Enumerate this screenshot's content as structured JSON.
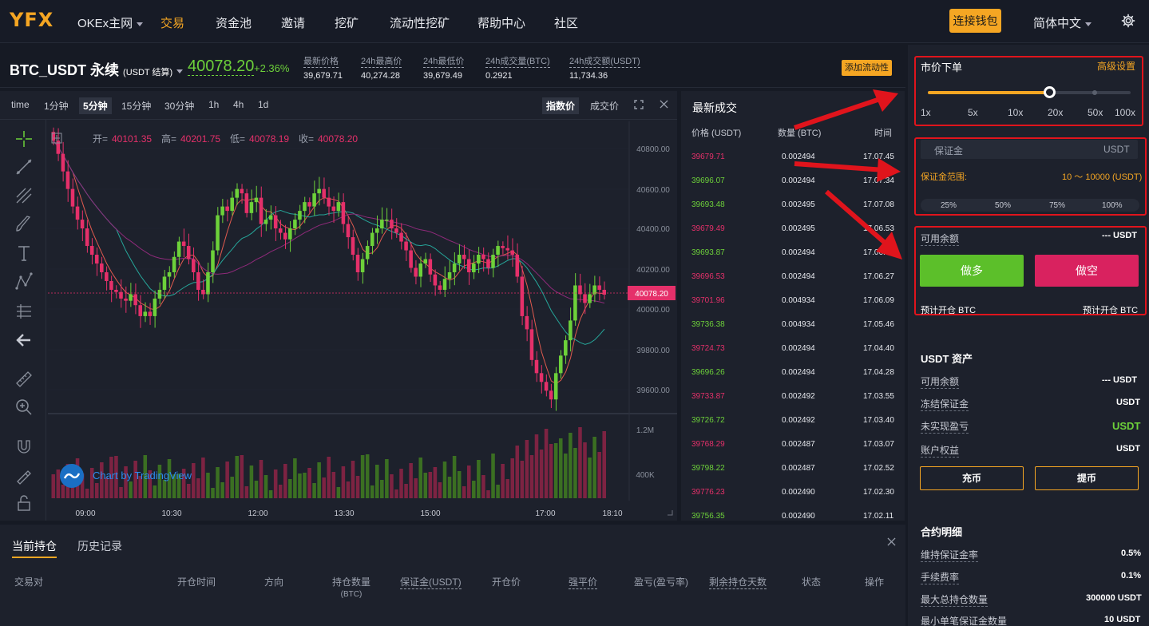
{
  "nav": {
    "logo": "YFX",
    "network": "OKEx主网",
    "items": [
      "交易",
      "资金池",
      "邀请",
      "挖矿",
      "流动性挖矿",
      "帮助中心",
      "社区"
    ],
    "connect_wallet": "连接钱包",
    "language": "简体中文",
    "settings_icon": "gear-icon"
  },
  "ticker": {
    "pair": "BTC_USDT 永续",
    "settle": "(USDT 结算)",
    "last_price": "40078.20",
    "change": "+2.36%",
    "stats": [
      {
        "label": "最新价格",
        "value": "39,679.71"
      },
      {
        "label": "24h最高价",
        "value": "40,274.28"
      },
      {
        "label": "24h最低价",
        "value": "39,679.49"
      },
      {
        "label": "24h成交量(BTC)",
        "value": "0.2921"
      },
      {
        "label": "24h成交额(USDT)",
        "value": "11,734.36"
      }
    ],
    "add_liquidity": "添加流动性"
  },
  "chart": {
    "timeframes": [
      "time",
      "1分钟",
      "5分钟",
      "15分钟",
      "30分钟",
      "1h",
      "4h",
      "1d"
    ],
    "selected_timeframe": "5分钟",
    "modes": [
      "指数价",
      "成交价"
    ],
    "ohlc": {
      "open_label": "开=",
      "open": "40101.35",
      "high_label": "高=",
      "high": "40201.75",
      "low_label": "低=",
      "low": "40078.19",
      "close_label": "收=",
      "close": "40078.20"
    },
    "watermark": "Chart by TradingView",
    "price_ticks": [
      "40800.00",
      "40600.00",
      "40400.00",
      "40200.00",
      "40000.00",
      "39800.00",
      "39600.00"
    ],
    "current_price_tag": "40078.20",
    "volume_ticks": [
      "1.2M",
      "400K"
    ],
    "time_ticks": [
      "09:00",
      "10:30",
      "12:00",
      "13:30",
      "15:00",
      "17:00",
      "18:10"
    ],
    "colors": {
      "up": "#6dd13a",
      "down": "#e5306a",
      "ma_red": "#e05a4f",
      "ma_green": "#26a69a",
      "ma_purple": "#8e2a7a"
    }
  },
  "chart_data": {
    "type": "candlestick",
    "ylim": [
      39550,
      40850
    ],
    "candles_close": [
      40780,
      40720,
      40640,
      40560,
      40480,
      40420,
      40380,
      40300,
      40260,
      40220,
      40180,
      40140,
      40100,
      40090,
      40060,
      40050,
      40080,
      40030,
      39980,
      40000,
      39980,
      40060,
      40100,
      40160,
      40180,
      40250,
      40320,
      40300,
      40240,
      40180,
      40100,
      40080,
      40180,
      40280,
      40440,
      40480,
      40460,
      40520,
      40560,
      40540,
      40450,
      40500,
      40520,
      40400,
      40420,
      40440,
      40380,
      40360,
      40330,
      40380,
      40420,
      40460,
      40500,
      40480,
      40540,
      40560,
      40520,
      40480,
      40460,
      40500,
      40400,
      40340,
      40260,
      40180,
      40240,
      40300,
      40360,
      40380,
      40420,
      40420,
      40380,
      40360,
      40320,
      40280,
      40200,
      40160,
      40220,
      40240,
      40170,
      40120,
      40100,
      40150,
      40180,
      40220,
      40260,
      40240,
      40180,
      40220,
      40260,
      40240,
      40200,
      40260,
      40300,
      40290,
      40280,
      40260,
      40160,
      39980,
      39920,
      39780,
      39720,
      39680,
      39640,
      39600,
      39720,
      39800,
      39870,
      39960,
      40120,
      40080,
      40040,
      40080,
      40120,
      40100,
      40078
    ]
  },
  "trades": {
    "title": "最新成交",
    "headers": [
      "价格 (USDT)",
      "数量 (BTC)",
      "时间"
    ],
    "rows": [
      {
        "price": "39679.71",
        "qty": "0.002494",
        "time": "17.07.45",
        "side": "sell"
      },
      {
        "price": "39696.07",
        "qty": "0.002494",
        "time": "17.07.34",
        "side": "buy"
      },
      {
        "price": "39693.48",
        "qty": "0.002495",
        "time": "17.07.08",
        "side": "buy"
      },
      {
        "price": "39679.49",
        "qty": "0.002495",
        "time": "17.06.53",
        "side": "sell"
      },
      {
        "price": "39693.87",
        "qty": "0.002494",
        "time": "17.06.38",
        "side": "buy"
      },
      {
        "price": "39696.53",
        "qty": "0.002494",
        "time": "17.06.27",
        "side": "sell"
      },
      {
        "price": "39701.96",
        "qty": "0.004934",
        "time": "17.06.09",
        "side": "sell"
      },
      {
        "price": "39736.38",
        "qty": "0.004934",
        "time": "17.05.46",
        "side": "buy"
      },
      {
        "price": "39724.73",
        "qty": "0.002494",
        "time": "17.04.40",
        "side": "sell"
      },
      {
        "price": "39696.26",
        "qty": "0.002494",
        "time": "17.04.28",
        "side": "buy"
      },
      {
        "price": "39733.87",
        "qty": "0.002492",
        "time": "17.03.55",
        "side": "sell"
      },
      {
        "price": "39726.72",
        "qty": "0.002492",
        "time": "17.03.40",
        "side": "buy"
      },
      {
        "price": "39768.29",
        "qty": "0.002487",
        "time": "17.03.07",
        "side": "sell"
      },
      {
        "price": "39798.22",
        "qty": "0.002487",
        "time": "17.02.52",
        "side": "buy"
      },
      {
        "price": "39776.23",
        "qty": "0.002490",
        "time": "17.02.30",
        "side": "sell"
      },
      {
        "price": "39756.35",
        "qty": "0.002490",
        "time": "17.02.11",
        "side": "buy"
      }
    ]
  },
  "positions": {
    "tabs": [
      "当前持仓",
      "历史记录"
    ],
    "columns": [
      "交易对",
      "开仓时间",
      "方向",
      "持仓数量",
      "(BTC)",
      "保证金(USDT)",
      "开仓价",
      "强平价",
      "盈亏(盈亏率)",
      "剩余持仓天数",
      "状态",
      "操作"
    ]
  },
  "order": {
    "title": "市价下单",
    "advanced": "高级设置",
    "leverage": [
      "1x",
      "5x",
      "10x",
      "20x",
      "50x",
      "100x"
    ],
    "leverage_selected": 20,
    "margin_label": "保证金",
    "margin_unit": "USDT",
    "margin_range_label": "保证金范围:",
    "margin_range": "10 ～ 10000 (USDT)",
    "percents": [
      "25%",
      "50%",
      "75%",
      "100%"
    ],
    "available_label": "可用余额",
    "available_value": "--- USDT",
    "long": "做多",
    "short": "做空",
    "est_long": "预计开仓 BTC",
    "est_short": "预计开仓 BTC"
  },
  "assets": {
    "title": "USDT 资产",
    "rows": [
      {
        "label": "可用余额",
        "value": "--- USDT"
      },
      {
        "label": "冻结保证金",
        "value": "USDT"
      },
      {
        "label": "未实现盈亏",
        "value": "USDT"
      },
      {
        "label": "账户权益",
        "value": "USDT"
      }
    ],
    "deposit": "充币",
    "withdraw": "提币"
  },
  "contract": {
    "title": "合约明细",
    "rows": [
      {
        "label": "维持保证金率",
        "value": "0.5%"
      },
      {
        "label": "手续费率",
        "value": "0.1%"
      },
      {
        "label": "最大总持仓数量",
        "value": "300000 USDT"
      },
      {
        "label": "最小单笔保证金数量",
        "value": "10 USDT"
      }
    ]
  }
}
